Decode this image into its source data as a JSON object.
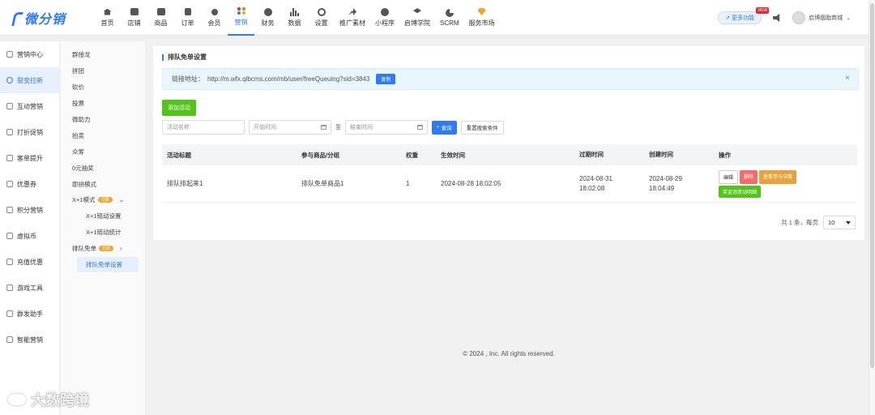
{
  "app": {
    "logo": "微分销"
  },
  "nav": [
    {
      "label": "首页",
      "icon": "home-icon"
    },
    {
      "label": "店铺",
      "icon": "store-icon"
    },
    {
      "label": "商品",
      "icon": "goods-icon"
    },
    {
      "label": "订单",
      "icon": "order-icon"
    },
    {
      "label": "会员",
      "icon": "member-icon"
    },
    {
      "label": "营销",
      "icon": "marketing-icon",
      "active": true
    },
    {
      "label": "财务",
      "icon": "finance-icon"
    },
    {
      "label": "数据",
      "icon": "data-icon"
    },
    {
      "label": "设置",
      "icon": "settings-icon"
    },
    {
      "label": "推广素材",
      "icon": "share-icon"
    },
    {
      "label": "小程序",
      "icon": "miniapp-icon"
    },
    {
      "label": "启博学院",
      "icon": "academy-icon"
    },
    {
      "label": "SCRM",
      "icon": "scrm-icon"
    },
    {
      "label": "服务市场",
      "icon": "market-icon"
    }
  ],
  "topright": {
    "more": "更多功能",
    "new_badge": "NEW",
    "user": "启博胭脂商城"
  },
  "side1": [
    "营销中心",
    "裂变拉新",
    "互动营销",
    "打折促销",
    "客单提升",
    "优惠券",
    "积分营销",
    "虚拟币",
    "充值优惠",
    "游戏工具",
    "群发助手",
    "智能营销"
  ],
  "side1_active": 1,
  "side2": {
    "items": [
      "群接龙",
      "拼团",
      "砍价",
      "投票",
      "微助力",
      "拍卖",
      "众筹",
      "0元抽奖",
      "即拼模式"
    ],
    "group1": {
      "label": "X+1模式",
      "badge": "付费"
    },
    "group1_children": [
      "X+1链动设置",
      "X+1链动统计"
    ],
    "group2": {
      "label": "排队免单",
      "badge": "付费"
    },
    "group2_children": [
      "排队免单设置"
    ]
  },
  "page": {
    "title": "排队免单设置",
    "link_label": "链接地址：",
    "link_url": "http://m.wfx.qlbcms.com/mb/user/freeQueuing?sid=3843",
    "copy": "复制",
    "add": "添加活动"
  },
  "filters": {
    "name_ph": "活动名称",
    "start_ph": "开始时间",
    "to": "至",
    "end_ph": "结束时间",
    "search": "查询",
    "reset": "重置搜索条件"
  },
  "table": {
    "headers": [
      "活动标题",
      "参与商品/分组",
      "权重",
      "生效时间",
      "过期时间",
      "创建时间",
      "操作"
    ],
    "rows": [
      {
        "title": "排队排起来1",
        "goods": "排队免单商品1",
        "weight": "1",
        "start": "2024-08-28 18:02:05",
        "expire_date": "2024-08-31",
        "expire_time": "18:02:08",
        "create_date": "2024-08-29",
        "create_time": "18:04:49",
        "ops": [
          "编辑",
          "删除",
          "查看参与详情",
          "奖金池变动明细"
        ]
      }
    ]
  },
  "pager": {
    "total": "共 1 条，每页",
    "size": "10"
  },
  "footer": "© 2024 , Inc. All rights reserved.",
  "watermark": "大数跨境"
}
